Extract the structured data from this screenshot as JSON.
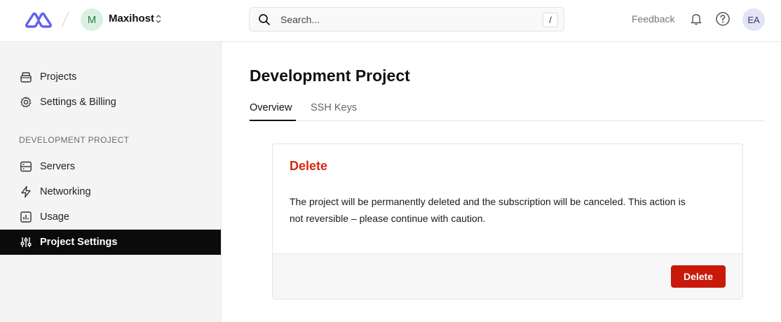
{
  "header": {
    "org": {
      "initial": "M",
      "name": "Maxihost"
    },
    "search": {
      "placeholder": "Search...",
      "shortcut": "/"
    },
    "feedback_label": "Feedback",
    "user_initials": "EA"
  },
  "sidebar": {
    "top_items": [
      {
        "label": "Projects",
        "icon": "box-icon"
      },
      {
        "label": "Settings & Billing",
        "icon": "gear-icon"
      }
    ],
    "section_label": "DEVELOPMENT PROJECT",
    "project_items": [
      {
        "label": "Servers",
        "icon": "server-icon"
      },
      {
        "label": "Networking",
        "icon": "lightning-icon"
      },
      {
        "label": "Usage",
        "icon": "chart-icon"
      },
      {
        "label": "Project Settings",
        "icon": "sliders-icon",
        "active": true
      }
    ]
  },
  "main": {
    "title": "Development Project",
    "tabs": [
      {
        "label": "Overview",
        "active": true
      },
      {
        "label": "SSH Keys",
        "active": false
      }
    ],
    "delete_card": {
      "title": "Delete",
      "body": "The project will be permanently deleted and the subscription will be canceled. This action is not reversible – please continue with caution.",
      "button_label": "Delete"
    }
  },
  "colors": {
    "brand": "#6360f0",
    "danger": "#c8190b",
    "danger_text": "#d42a10",
    "sidebar_active": "#0b0b0c"
  }
}
